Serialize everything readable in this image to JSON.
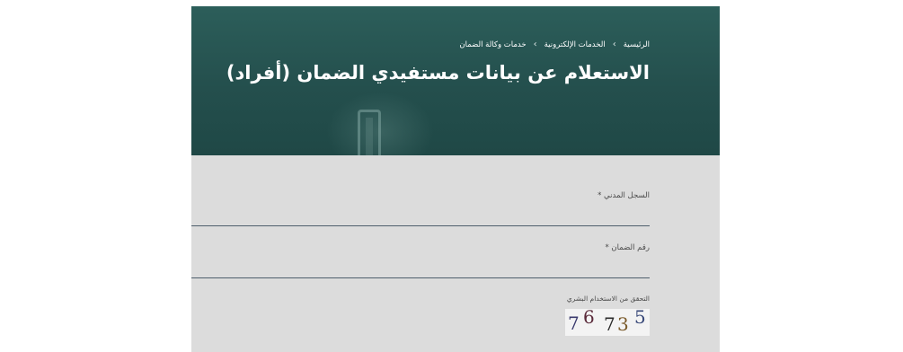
{
  "breadcrumb": {
    "items": [
      "الرئيسية",
      "الخدمات الإلكترونية",
      "خدمات وكالة الضمان"
    ],
    "separator": "›"
  },
  "page_title": "الاستعلام عن بيانات مستفيدي الضمان (أفراد)",
  "form": {
    "civil_id_label": "السجل المدني *",
    "civil_id_value": "",
    "guarantee_number_label": "رقم الضمان *",
    "guarantee_number_value": "",
    "captcha_label": "التحقق من الاستخدام البشري",
    "captcha_chars": [
      "7",
      "6",
      "7",
      "3",
      "5"
    ],
    "captcha_colors": [
      "#3a3a6e",
      "#5a2a3a",
      "#2a2a2a",
      "#7a5a2a",
      "#3a4a7a"
    ]
  },
  "colors": {
    "header_bg": "#244f4d",
    "form_bg": "#dcdcdc",
    "field_border": "#4f5f6c"
  }
}
